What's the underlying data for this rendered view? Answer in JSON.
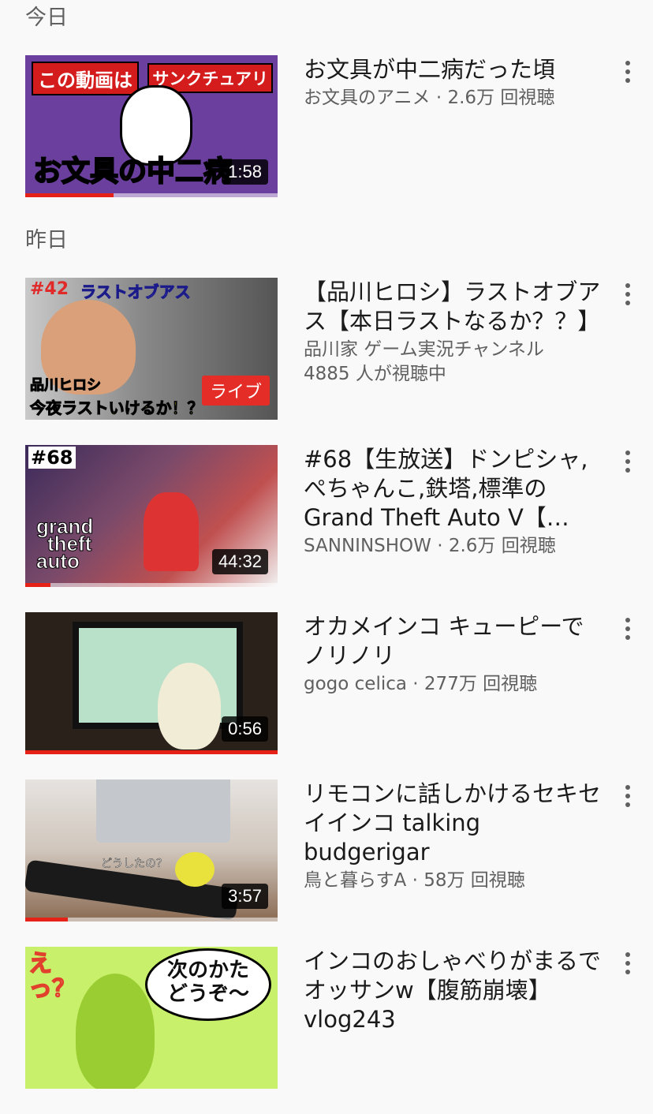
{
  "sections": [
    {
      "header": "今日",
      "videos": [
        {
          "title": "お文具が中二病だった頃",
          "channel": "お文具のアニメ",
          "views": "2.6万 回視聴",
          "duration": "1:58",
          "progress": 0.35,
          "thumb_text": [
            "この動画は",
            "サンクチュアリ",
            "お文具の中二病"
          ]
        }
      ]
    },
    {
      "header": "昨日",
      "videos": [
        {
          "title": "【品川ヒロシ】ラストオブアス【本日ラストなるか？？】",
          "channel": "品川家 ゲーム実況チャンネル",
          "views": "4885 人が視聴中",
          "live": "ライブ",
          "thumb_text": [
            "#42",
            "ラストオブアス",
            "品川ヒロシ",
            "今夜ラストいけるか！？"
          ]
        },
        {
          "title": "#68【生放送】ドンピシャ,ぺちゃんこ,鉄塔,標準のGrand Theft Auto V【…",
          "channel": "SANNINSHOW",
          "views": "2.6万 回視聴",
          "duration": "44:32",
          "progress": 0.1,
          "thumb_text": [
            "#68",
            "grand",
            "theft",
            "auto"
          ]
        },
        {
          "title": "オカメインコ キューピーでノリノリ",
          "channel": "gogo celica",
          "views": "277万 回視聴",
          "duration": "0:56",
          "progress": 1.0,
          "thumb_text": []
        },
        {
          "title": "リモコンに話しかけるセキセイインコ talking budgerigar",
          "channel": "鳥と暮らすA",
          "views": "58万 回視聴",
          "duration": "3:57",
          "progress": 0.17,
          "thumb_text": [
            "どうしたの？"
          ]
        },
        {
          "title": "インコのおしゃべりがまるでオッサンw【腹筋崩壊】vlog243",
          "channel": "",
          "views": "",
          "thumb_text": [
            "えっ？",
            "次のかた",
            "どうぞ〜"
          ]
        }
      ]
    }
  ],
  "meta_separator": " · ",
  "icons": {
    "menu": "more-vert-icon"
  },
  "colors": {
    "progress": "#e62117",
    "live": "#e52d27",
    "meta_text": "#606060"
  }
}
